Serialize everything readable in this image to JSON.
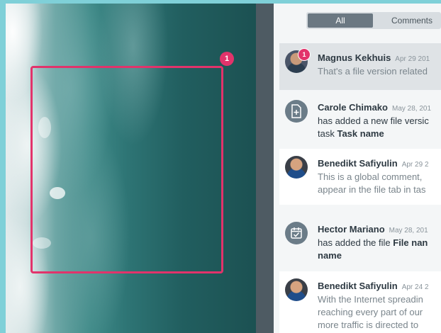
{
  "filter_tabs": {
    "all": "All",
    "comments": "Comments"
  },
  "marker": {
    "number": "1"
  },
  "feed": [
    {
      "name": "Magnus Kekhuis",
      "date": "Apr 29 201",
      "lines": [
        "That's a file version related"
      ],
      "badge": "1",
      "avatar": "photo"
    },
    {
      "name": "Carole Chimako",
      "date": "May 28, 201",
      "line1": "has added a new file versic",
      "line2_prefix": "task ",
      "line2_bold": "Task name",
      "avatar": "file-version-icon"
    },
    {
      "name": "Benedikt Safiyulin",
      "date": "Apr 29 2",
      "lines": [
        "This is a global comment, ",
        "appear in the file tab in tas"
      ],
      "avatar": "photo"
    },
    {
      "name": "Hector Mariano",
      "date": "May 28, 201",
      "line1_prefix": "has added the file ",
      "line1_bold": "File nan",
      "line2_bold": "name",
      "avatar": "file-added-icon"
    },
    {
      "name": "Benedikt Safiyulin",
      "date": "Apr 24 2",
      "lines": [
        "With the Internet spreadin",
        "reaching every part of our ",
        "more traffic is directed to "
      ],
      "avatar": "photo"
    }
  ]
}
